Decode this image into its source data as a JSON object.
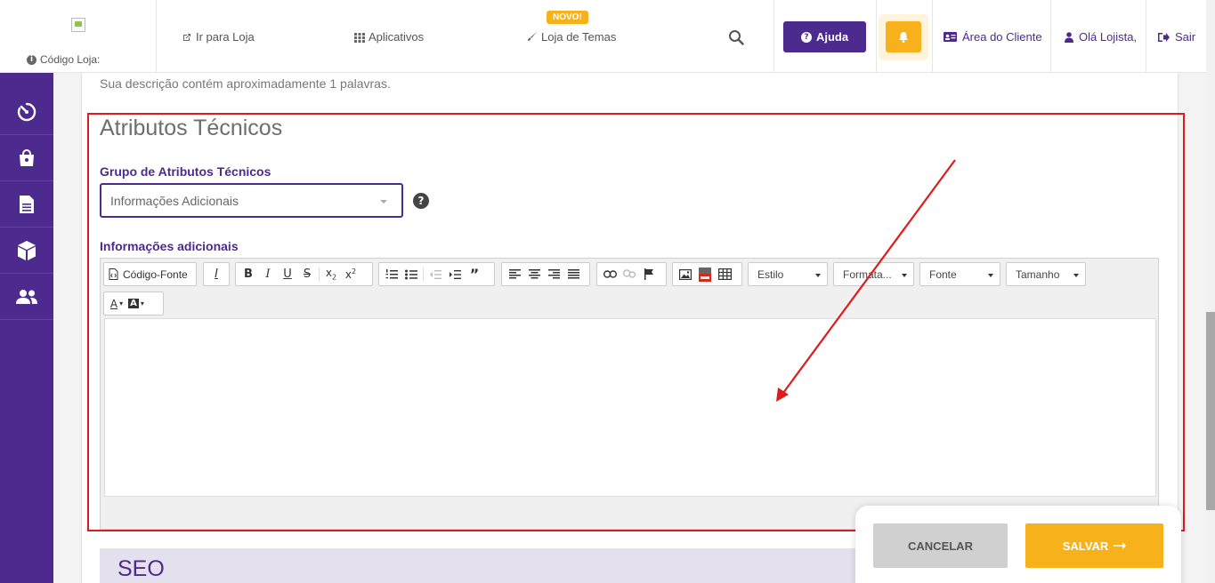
{
  "header": {
    "store_code_label": "Código Loja:",
    "nav": {
      "go_to_store": "Ir para Loja",
      "apps": "Aplicativos",
      "themes": "Loja de Temas",
      "new_badge": "NOVO!"
    },
    "help_label": "Ajuda",
    "client_area": "Área do Cliente",
    "greeting": "Olá Lojista,",
    "logout": "Sair"
  },
  "sidebar": {
    "items": [
      "dashboard-gauge-icon",
      "shopping-bag-icon",
      "document-icon",
      "box-icon",
      "users-icon"
    ]
  },
  "content": {
    "description_note": "Sua descrição contém aproximadamente 1 palavras.",
    "section_title": "Atributos Técnicos",
    "group_label": "Grupo de Atributos Técnicos",
    "group_value": "Informações Adicionais",
    "additional_label": "Informações adicionais",
    "seo_title": "SEO"
  },
  "editor": {
    "source_label": "Código-Fonte",
    "style_combo": "Estilo",
    "format_combo": "Formata...",
    "font_combo": "Fonte",
    "size_combo": "Tamanho",
    "text_color": "A",
    "bg_color": "A"
  },
  "actions": {
    "cancel": "CANCELAR",
    "save": "SALVAR"
  },
  "colors": {
    "brand_purple": "#4d2a8e",
    "accent_yellow": "#f7b21b",
    "annotation_red": "#e01b1b"
  }
}
